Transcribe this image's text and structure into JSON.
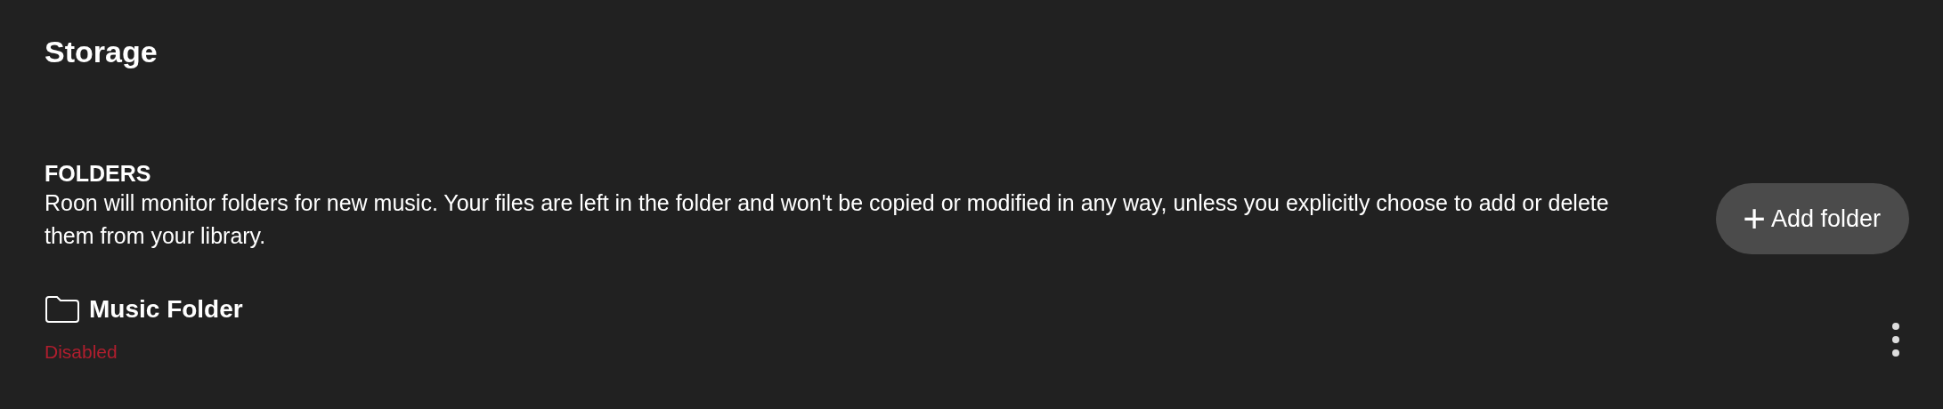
{
  "page": {
    "title": "Storage"
  },
  "section": {
    "heading": "FOLDERS",
    "description": "Roon will monitor folders for new music. Your files are left in the folder and won't be copied or modified in any way, unless you explicitly choose to add or delete them from your library."
  },
  "add_button": {
    "icon": "+",
    "label": "Add folder"
  },
  "folders": [
    {
      "name": "Music Folder",
      "status": "Disabled",
      "disabled": true
    }
  ]
}
